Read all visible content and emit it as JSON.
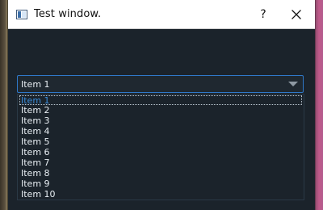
{
  "window": {
    "title": "Test window.",
    "help_label": "?",
    "close_icon": "close-icon"
  },
  "combo": {
    "selected_value": "Item 1",
    "arrow_icon": "chevron-down-icon"
  },
  "dropdown": {
    "items": [
      {
        "label": "Item 1"
      },
      {
        "label": "Item 2"
      },
      {
        "label": "Item 3"
      },
      {
        "label": "Item 4"
      },
      {
        "label": "Item 5"
      },
      {
        "label": "Item 6"
      },
      {
        "label": "Item 7"
      },
      {
        "label": "Item 8"
      },
      {
        "label": "Item 9"
      },
      {
        "label": "Item 10"
      }
    ]
  },
  "colors": {
    "window_bg": "#1b232b",
    "accent_border": "#2f78c9",
    "selected_text": "#3a8bd8",
    "text": "#e8eef3"
  }
}
